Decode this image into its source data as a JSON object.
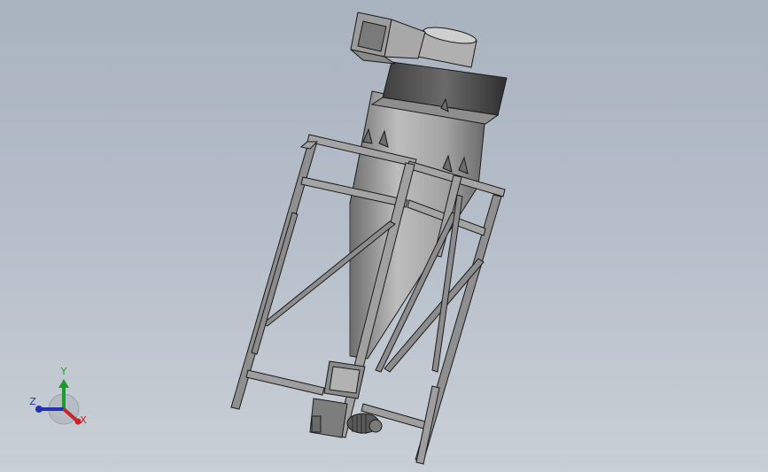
{
  "viewport": {
    "background_top": "#a9b3bf",
    "background_bottom": "#c9cfd6"
  },
  "model": {
    "name": "cyclone-separator-with-frame",
    "part_color": "#9a9a9a",
    "edge_color": "#1a1a1a"
  },
  "triad": {
    "x_label": "X",
    "y_label": "Y",
    "z_label": "Z",
    "x_color": "#c8222a",
    "y_color": "#1f9a2e",
    "z_color": "#2233b0"
  }
}
